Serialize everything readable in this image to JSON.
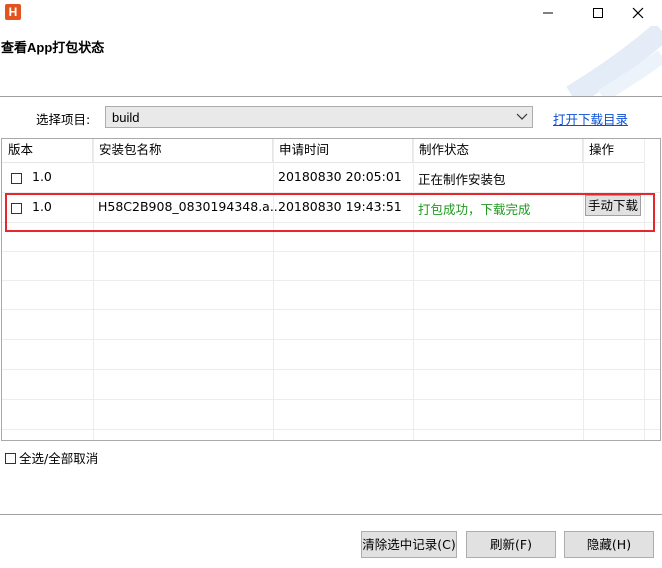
{
  "window": {
    "app_icon_letter": "H",
    "minimize_icon": "minimize-icon",
    "maximize_icon": "maximize-icon",
    "close_icon": "close-icon"
  },
  "header": {
    "title": "查看App打包状态"
  },
  "project": {
    "label": "选择项目:",
    "selected": "build",
    "open_dir_link": "打开下载目录"
  },
  "table": {
    "columns": [
      "版本",
      "安装包名称",
      "申请时间",
      "制作状态",
      "操作"
    ],
    "rows": [
      {
        "checked": false,
        "version": "1.0",
        "package": "",
        "time": "20180830 20:05:01",
        "status": "正在制作安装包",
        "action": ""
      },
      {
        "checked": false,
        "version": "1.0",
        "package": "H58C2B908_0830194348.a...",
        "time": "20180830 19:43:51",
        "status": "打包成功，下载完成",
        "action": "手动下载"
      }
    ]
  },
  "select_all_label": "全选/全部取消",
  "buttons": {
    "clear": "清除选中记录(C)",
    "refresh": "刷新(F)",
    "hide": "隐藏(H)"
  },
  "colors": {
    "success": "#1e9a1e",
    "link": "#0b4fd0",
    "highlight": "#e8262b",
    "app_icon": "#e2531e"
  }
}
